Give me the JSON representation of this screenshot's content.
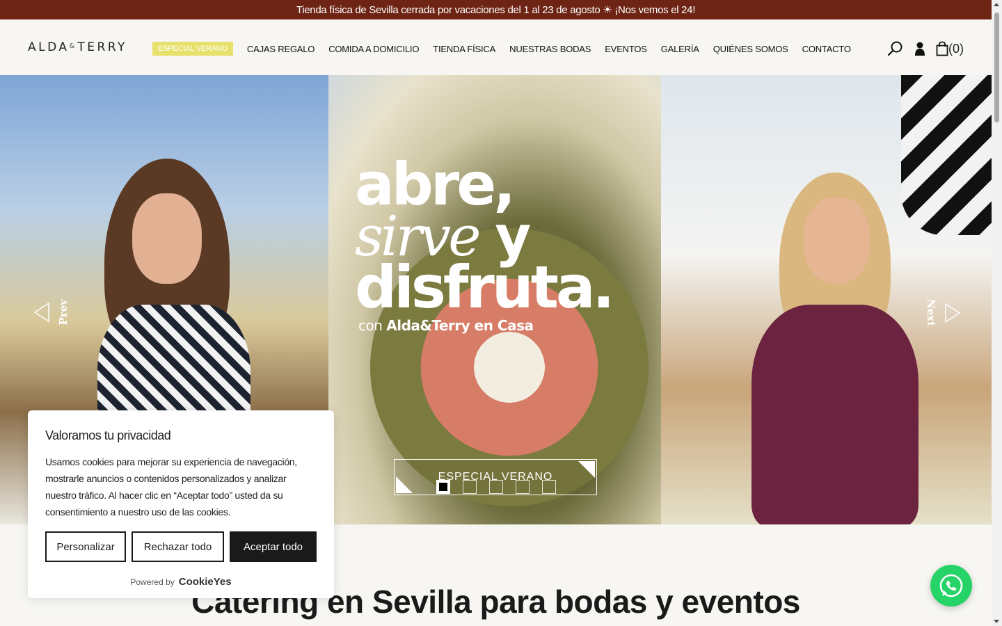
{
  "announcement": "Tienda física de Sevilla cerrada por vacaciones del 1 al 23 de agosto ☀ ¡Nos vemos el 24!",
  "logo": {
    "left": "ALDA",
    "amp": "&",
    "right": "TERRY"
  },
  "nav": {
    "items": [
      {
        "label": "ESPECIAL VERANO"
      },
      {
        "label": "CAJAS REGALO"
      },
      {
        "label": "COMIDA A DOMICILIO"
      },
      {
        "label": "TIENDA FÍSICA"
      },
      {
        "label": "NUESTRAS BODAS"
      },
      {
        "label": "EVENTOS"
      },
      {
        "label": "GALERÍA"
      },
      {
        "label": "QUIÉNES SOMOS"
      },
      {
        "label": "CONTACTO"
      }
    ],
    "highlight_color": "#e7e06a"
  },
  "header_icons": {
    "search": "search-icon",
    "account": "user-icon",
    "cart": "cart-icon",
    "cart_count": "(0)"
  },
  "hero": {
    "line1": "abre,",
    "line2_italic": "sirve",
    "line2_rest": " y",
    "line3": "disfruta.",
    "line4_pre": "con ",
    "line4_bold": "Alda&Terry en Casa",
    "cta": "ESPECIAL VERANO",
    "prev": "Prev",
    "next": "Next",
    "slides_total": 5,
    "active_slide": 1
  },
  "section_title": "Catering en Sevilla para bodas y eventos",
  "cookie": {
    "title": "Valoramos tu privacidad",
    "text": "Usamos cookies para mejorar su experiencia de navegación, mostrarle anuncios o contenidos personalizados y analizar nuestro tráfico. Al hacer clic en “Aceptar todo” usted da su consentimiento a nuestro uso de las cookies.",
    "btn_customize": "Personalizar",
    "btn_reject": "Rechazar todo",
    "btn_accept": "Aceptar todo",
    "powered_by": "Powered by",
    "brand": "CookieYes"
  },
  "colors": {
    "topbar": "#6e2414",
    "whatsapp": "#25d366",
    "accent": "#e7e06a"
  }
}
